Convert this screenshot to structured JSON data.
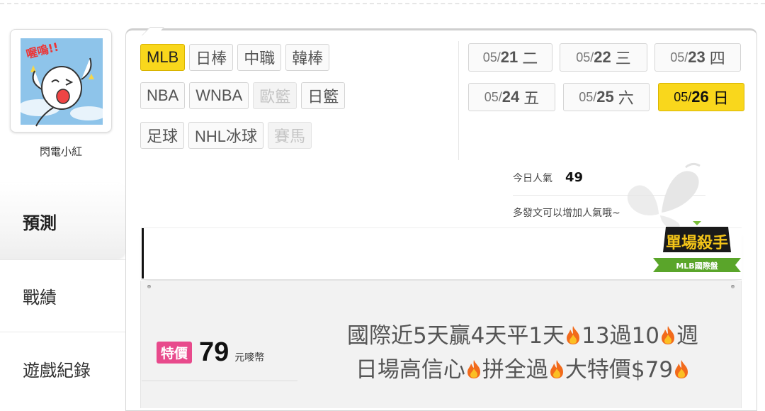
{
  "user": {
    "name": "閃電小紅",
    "avatar_caption": "喔嗚!!"
  },
  "sidebar": {
    "tabs": [
      {
        "label": "預測"
      },
      {
        "label": "戰績"
      },
      {
        "label": "遊戲紀錄"
      }
    ]
  },
  "leagues": {
    "rows": [
      [
        {
          "label": "MLB"
        },
        {
          "label": "日棒"
        },
        {
          "label": "中職"
        },
        {
          "label": "韓棒"
        }
      ],
      [
        {
          "label": "NBA"
        },
        {
          "label": "WNBA"
        },
        {
          "label": "歐籃"
        },
        {
          "label": "日籃"
        }
      ],
      [
        {
          "label": "足球"
        },
        {
          "label": "NHL冰球"
        },
        {
          "label": "賽馬"
        }
      ]
    ]
  },
  "dates": [
    {
      "month": "05/",
      "day": "21",
      "weekday": "二"
    },
    {
      "month": "05/",
      "day": "22",
      "weekday": "三"
    },
    {
      "month": "05/",
      "day": "23",
      "weekday": "四"
    },
    {
      "month": "05/",
      "day": "24",
      "weekday": "五"
    },
    {
      "month": "05/",
      "day": "25",
      "weekday": "六"
    },
    {
      "month": "05/",
      "day": "26",
      "weekday": "日"
    }
  ],
  "popularity": {
    "label": "今日人氣",
    "value": "49",
    "tip": "多發文可以增加人氣哦~"
  },
  "badge": {
    "title": "單場殺手",
    "subtitle": "MLB國際盤"
  },
  "post": {
    "sale_label": "特價",
    "price": "79",
    "currency": "元嘜幣",
    "headline_line1": [
      "國際近5天贏4天平1天",
      "13過10",
      "週"
    ],
    "headline_line2": [
      "日場高信心",
      "拼全過",
      "大特價$79",
      ""
    ]
  },
  "colors": {
    "accent_yellow": "#f9d71c",
    "sale_pink": "#e84a8c"
  }
}
